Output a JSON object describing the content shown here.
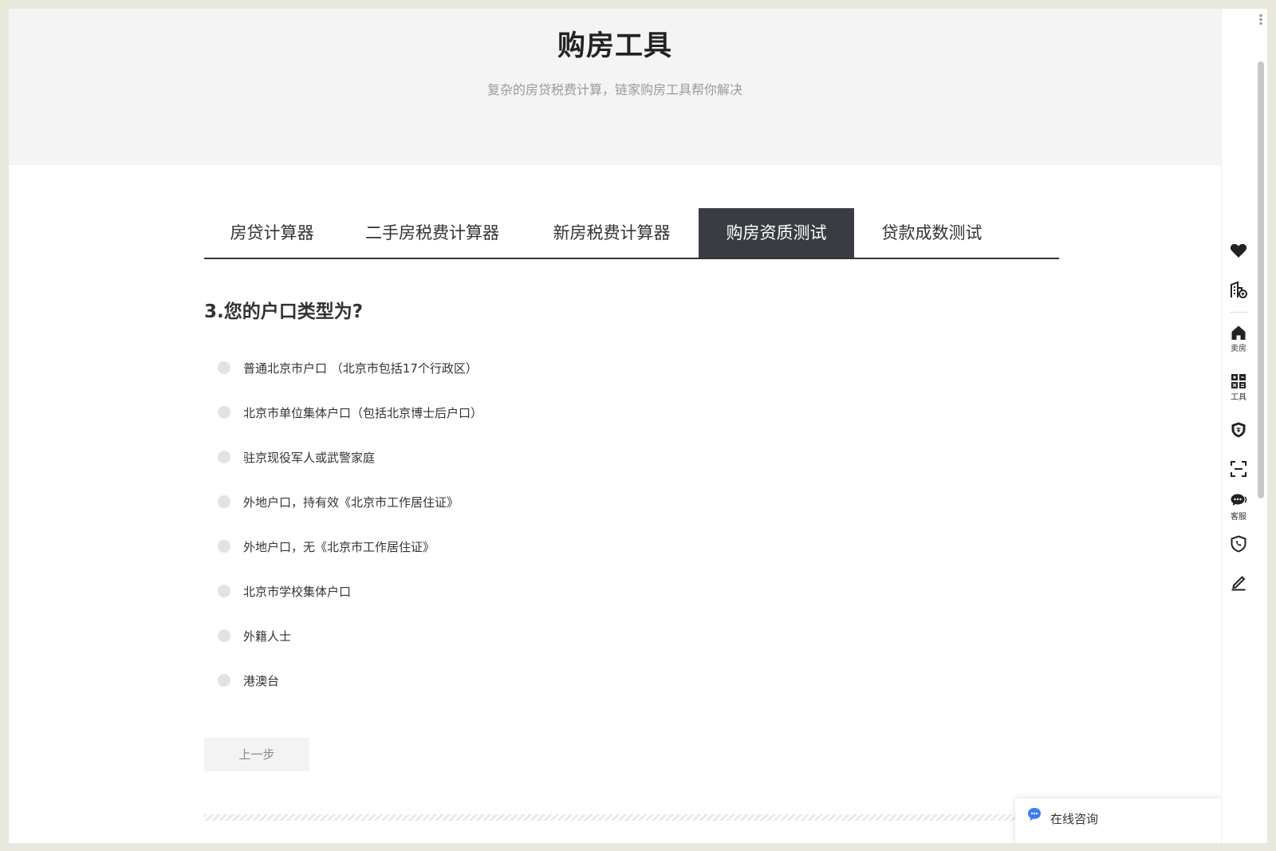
{
  "hero": {
    "title": "购房工具",
    "subtitle": "复杂的房贷税费计算，链家购房工具帮你解决"
  },
  "tabs": [
    {
      "label": "房贷计算器",
      "active": false
    },
    {
      "label": "二手房税费计算器",
      "active": false
    },
    {
      "label": "新房税费计算器",
      "active": false
    },
    {
      "label": "购房资质测试",
      "active": true
    },
    {
      "label": "贷款成数测试",
      "active": false
    }
  ],
  "question": "3.您的户口类型为?",
  "options": [
    "普通北京市户口 （北京市包括17个行政区）",
    "北京市单位集体户口（包括北京博士后户口）",
    "驻京现役军人或武警家庭",
    "外地户口，持有效《北京市工作居住证》",
    "外地户口，无《北京市工作居住证》",
    "北京市学校集体户口",
    "外籍人士",
    "港澳台"
  ],
  "prev_button": "上一步",
  "chat": {
    "label": "在线咨询",
    "icon": "chat-bubble-icon"
  },
  "sidebar": {
    "items": [
      {
        "icon": "heart-icon",
        "label": ""
      },
      {
        "icon": "building-compare-icon",
        "label": ""
      },
      {
        "icon": "home-icon",
        "label": "卖房"
      },
      {
        "icon": "calculator-icon",
        "label": "工具"
      },
      {
        "icon": "shield-icon",
        "label": ""
      },
      {
        "icon": "scan-icon",
        "label": ""
      },
      {
        "icon": "chat-icon",
        "label": "客服"
      },
      {
        "icon": "phone-icon",
        "label": ""
      },
      {
        "icon": "edit-icon",
        "label": ""
      }
    ]
  },
  "colors": {
    "active_tab_bg": "#393d41",
    "hero_bg": "#f4f4f4",
    "chat_icon": "#3b7cf6"
  }
}
